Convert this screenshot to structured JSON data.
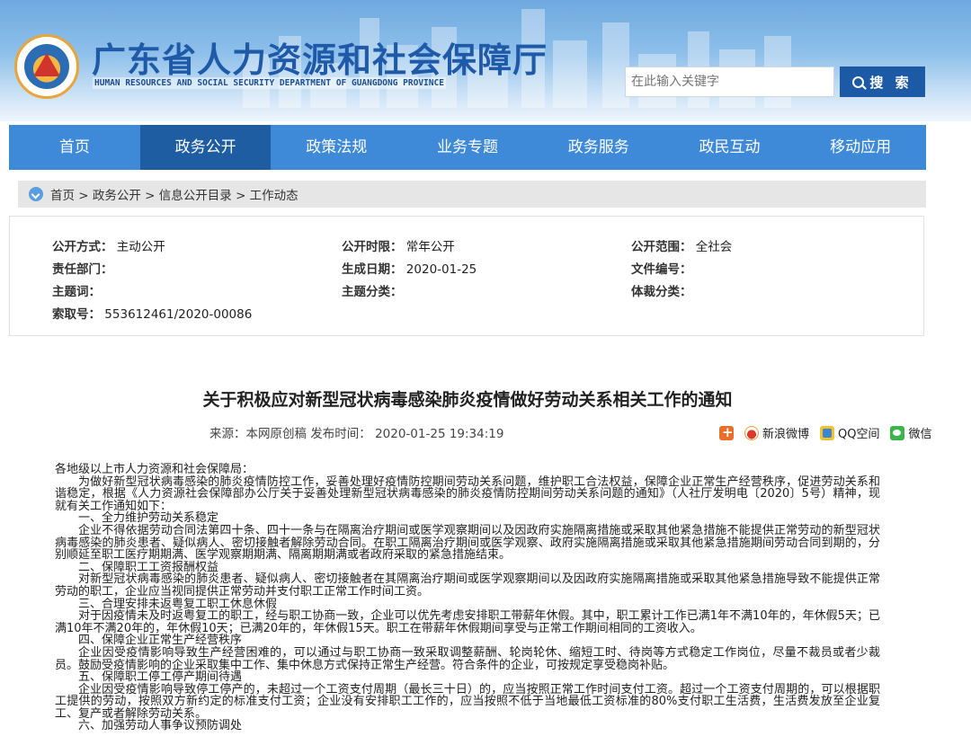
{
  "header": {
    "site_title": "广东省人力资源和社会保障厅",
    "site_subtitle": "HUMAN RESOURCES AND SOCIAL SECURITY DEPARTMENT OF GUANGDONG PROVINCE",
    "search_placeholder": "在此输入关键字",
    "search_button": "搜 索"
  },
  "nav": {
    "items": [
      {
        "label": "首页"
      },
      {
        "label": "政务公开"
      },
      {
        "label": "政策法规"
      },
      {
        "label": "业务专题"
      },
      {
        "label": "政务服务"
      },
      {
        "label": "政民互动"
      },
      {
        "label": "移动应用"
      }
    ],
    "active_index": 1
  },
  "breadcrumb": "首页 > 政务公开 > 信息公开目录 > 工作动态",
  "meta": {
    "gkfs_label": "公开方式：",
    "gkfs_value": "主动公开",
    "gksx_label": "公开时限：",
    "gksx_value": "常年公开",
    "gkfw_label": "公开范围：",
    "gkfw_value": "全社会",
    "zrbm_label": "责任部门：",
    "zrbm_value": "",
    "scrq_label": "生成日期：",
    "scrq_value": "2020-01-25",
    "wjbh_label": "文件编号：",
    "wjbh_value": "",
    "ztc_label": "主题词：",
    "ztc_value": "",
    "ztfl_label": "主题分类：",
    "ztfl_value": "",
    "tcfl_label": "体裁分类：",
    "tcfl_value": "",
    "syh_label": "索取号：",
    "syh_value": "553612461/2020-00086"
  },
  "article": {
    "title": "关于积极应对新型冠状病毒感染肺炎疫情做好劳动关系相关工作的通知",
    "source": "来源：本网原创稿   发布时间： 2020-01-25 19:34:19",
    "share": {
      "weibo": "新浪微博",
      "qzone": "QQ空间",
      "wechat": "微信"
    },
    "paragraphs": [
      "各地级以上市人力资源和社会保障局：",
      "为做好新型冠状病毒感染的肺炎疫情防控工作，妥善处理好疫情防控期间劳动关系问题，维护职工合法权益，保障企业正常生产经营秩序，促进劳动关系和谐稳定，根据《人力资源社会保障部办公厅关于妥善处理新型冠状病毒感染的肺炎疫情防控期间劳动关系问题的通知》（人社厅发明电〔2020〕5号）精神，现就有关工作通知如下：",
      "一、全力维护劳动关系稳定",
      "企业不得依据劳动合同法第四十条、四十一条与在隔离治疗期间或医学观察期间以及因政府实施隔离措施或采取其他紧急措施不能提供正常劳动的新型冠状病毒感染的肺炎患者、疑似病人、密切接触者解除劳动合同。在职工隔离治疗期间或医学观察、政府实施隔离措施或采取其他紧急措施期间劳动合同到期的，分别顺延至职工医疗期期满、医学观察期期满、隔离期期满或者政府采取的紧急措施结束。",
      "二、保障职工工资报酬权益",
      "对新型冠状病毒感染的肺炎患者、疑似病人、密切接触者在其隔离治疗期间或医学观察期间以及因政府实施隔离措施或采取其他紧急措施导致不能提供正常劳动的职工，企业应当视同提供正常劳动并支付职工正常工作时间工资。",
      "三、合理安排未返粤复工职工休息休假",
      "对于因疫情未及时返粤复工的职工，经与职工协商一致，企业可以优先考虑安排职工带薪年休假。其中，职工累计工作已满1年不满10年的，年休假5天；已满10年不满20年的，年休假10天；已满20年的，年休假15天。职工在带薪年休假期间享受与正常工作期间相同的工资收入。",
      "四、保障企业正常生产经营秩序",
      "企业因受疫情影响导致生产经营困难的，可以通过与职工协商一致采取调整薪酬、轮岗轮休、缩短工时、待岗等方式稳定工作岗位，尽量不裁员或者少裁员。鼓励受疫情影响的企业采取集中工作、集中休息方式保持正常生产经营。符合条件的企业，可按规定享受稳岗补贴。",
      "五、保障职工停工停产期间待遇",
      "企业因受疫情影响导致停工停产的，未超过一个工资支付周期（最长三十日）的，应当按照正常工作时间支付工资。超过一个工资支付周期的，可以根据职工提供的劳动，按照双方新约定的标准支付工资；企业没有安排职工工作的，应当按照不低于当地最低工资标准的80%支付职工生活费，生活费发放至企业复工、复产或者解除劳动关系。",
      "六、加强劳动人事争议预防调处"
    ]
  },
  "colors": {
    "brand_blue": "#1e5aa8",
    "nav_bg": "#3f8ad8",
    "nav_active": "#1f5da3",
    "search_button": "#1d5aa6"
  }
}
